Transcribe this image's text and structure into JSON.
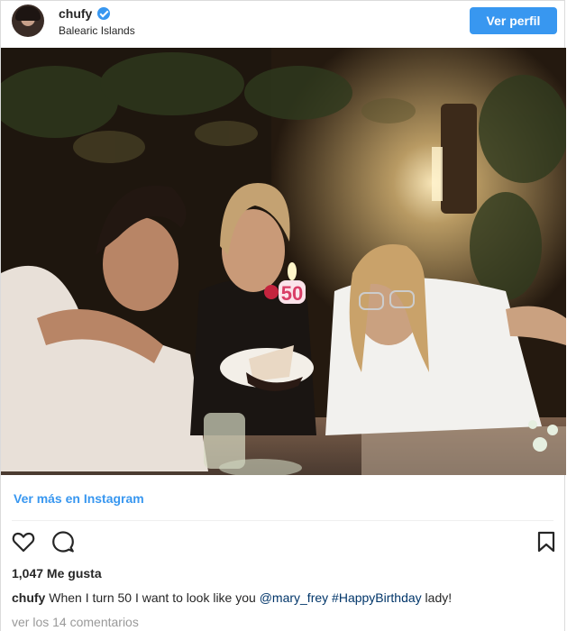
{
  "header": {
    "username": "chufy",
    "location": "Balearic Islands",
    "profile_button": "Ver perfil",
    "avatar_icon": "profile-avatar",
    "verified_icon": "verified-badge-icon"
  },
  "photo": {
    "cake_candle_number": "50"
  },
  "more_link": "Ver más en Instagram",
  "actions": {
    "like_icon": "heart-icon",
    "comment_icon": "comment-bubble-icon",
    "save_icon": "bookmark-icon"
  },
  "likes": "1,047 Me gusta",
  "caption": {
    "username": "chufy",
    "text_before": "When I turn 50 I want to look like you ",
    "mention": "@mary_frey",
    "space": " ",
    "hashtag": "#HappyBirthday",
    "text_after": " lady!"
  },
  "comments": "ver los 14 comentarios",
  "colors": {
    "accent": "#3897f0",
    "tag": "#003569",
    "muted": "#999999"
  }
}
